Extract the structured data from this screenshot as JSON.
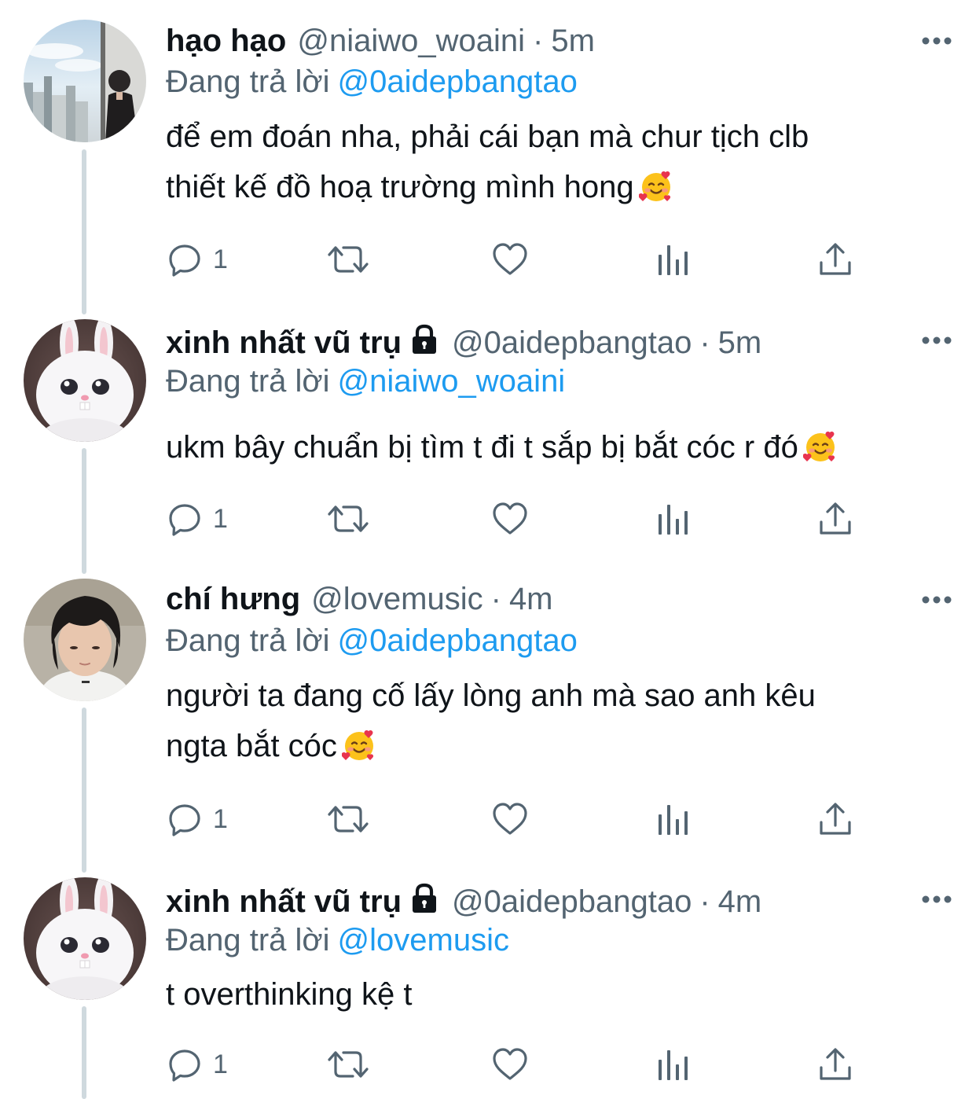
{
  "reply_prefix": "Đang trả lời",
  "colors": {
    "link": "#1d9bf0",
    "secondary_text": "#536471",
    "icon": "#536471",
    "thread_line": "#cfd9de"
  },
  "tweets": [
    {
      "display_name": "hạo hạo",
      "handle": "@niaiwo_woaini",
      "separator": "·",
      "time": "5m",
      "protected": false,
      "reply_to": "@0aidepbangtao",
      "lines": [
        "để em đoán nha, phải cái bạn mà chur tịch clb",
        "thiết kế đồ hoạ trường mình hong"
      ],
      "emoji": "smiling-face-with-hearts",
      "reply_count": "1",
      "avatar": "profile-photo-city-window"
    },
    {
      "display_name": "xinh nhất vũ trụ",
      "handle": "@0aidepbangtao",
      "separator": "·",
      "time": "5m",
      "protected": true,
      "reply_to": "@niaiwo_woaini",
      "lines": [
        "ukm bây chuẩn bị tìm t đi t sắp bị bắt cóc r đó"
      ],
      "emoji": "smiling-face-with-hearts",
      "reply_count": "1",
      "avatar": "white-bunny"
    },
    {
      "display_name": "chí hưng",
      "handle": "@lovemusic",
      "separator": "·",
      "time": "4m",
      "protected": false,
      "reply_to": "@0aidepbangtao",
      "lines": [
        "người ta đang cố lấy lòng anh mà sao anh kêu",
        "ngta bắt cóc"
      ],
      "emoji": "smiling-face-with-hearts",
      "reply_count": "1",
      "avatar": "profile-photo-person"
    },
    {
      "display_name": "xinh nhất vũ trụ",
      "handle": "@0aidepbangtao",
      "separator": "·",
      "time": "4m",
      "protected": true,
      "reply_to": "@lovemusic",
      "lines": [
        "t overthinking kệ t"
      ],
      "emoji": null,
      "reply_count": "1",
      "avatar": "white-bunny"
    }
  ]
}
